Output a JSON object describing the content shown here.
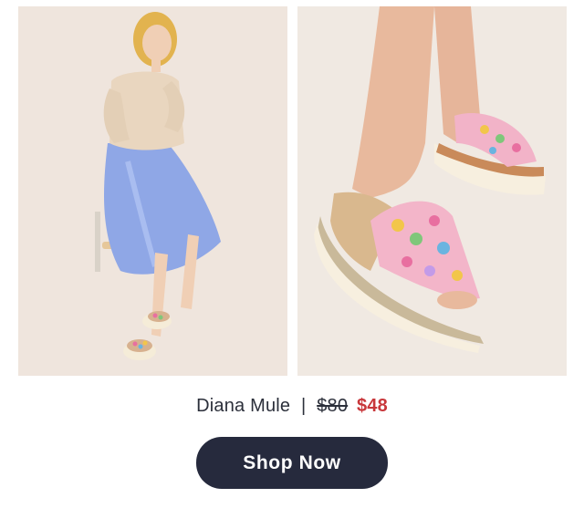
{
  "product": {
    "name": "Diana Mule",
    "separator": "|",
    "original_price": "$80",
    "sale_price": "$48"
  },
  "cta": {
    "label": "Shop Now"
  },
  "images": {
    "left": "model-seated-wearing-floral-mules",
    "right": "closeup-floral-platform-mule-on-foot"
  },
  "colors": {
    "sale_price": "#c8373b",
    "button_bg": "#262a3d",
    "text": "#2b2f3a"
  }
}
